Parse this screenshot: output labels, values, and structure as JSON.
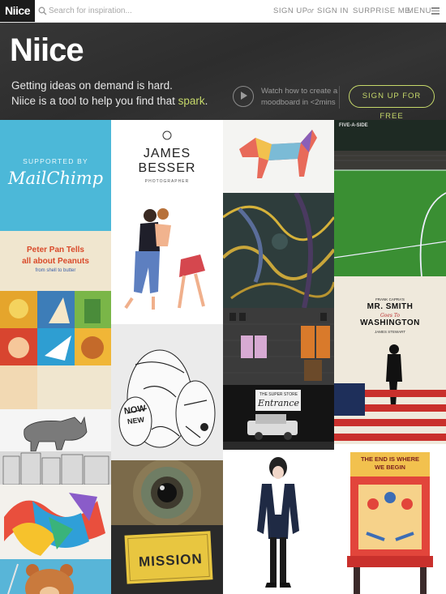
{
  "topbar": {
    "logo": "Niice",
    "search_placeholder": "Search for inspiration...",
    "sign_up": "SIGN UP",
    "or": "or",
    "sign_in": "SIGN IN",
    "surprise_me": "SURPRISE ME",
    "menu": "MENU"
  },
  "hero": {
    "logo": "Niice",
    "tagline_line1": "Getting ideas on demand is hard.",
    "tagline_line2_prefix": "Niice is a tool to help you find that ",
    "tagline_accent": "spark",
    "tagline_suffix": ".",
    "watch_text": "Watch how to create a moodboard in <2mins",
    "signup_button": "SIGN UP FOR FREE",
    "accent_color": "#c6d96a"
  },
  "tiles": {
    "mailchimp": {
      "supported_by": "SUPPORTED BY",
      "brand": "MailChimp",
      "bg": "#4cb8d8"
    },
    "james_besser": {
      "line1": "JAMES",
      "line2": "BESSER",
      "sub": "PHOTOGRAPHER"
    },
    "peter_pan": {
      "line1": "Peter Pan Tells",
      "line2": "all about Peanuts",
      "line3": "from shell to butter"
    },
    "vase_words": {
      "word1": "NOW",
      "word2": "NEW"
    },
    "mr_smith": {
      "small": "FRANK CAPRA'S",
      "line1": "MR. SMITH",
      "line2": "Goes To",
      "line3": "WASHINGTON",
      "credit": "JAMES STEWART"
    },
    "entrance": {
      "sign_top": "THE SUPER STORE",
      "sign_main": "Entrance"
    },
    "five_a_side": {
      "sign": "FIVE-A-SIDE"
    },
    "pinball": {
      "line1": "THE END IS WHERE",
      "line2": "WE BEGIN"
    },
    "mission": {
      "word": "MISSION"
    }
  }
}
